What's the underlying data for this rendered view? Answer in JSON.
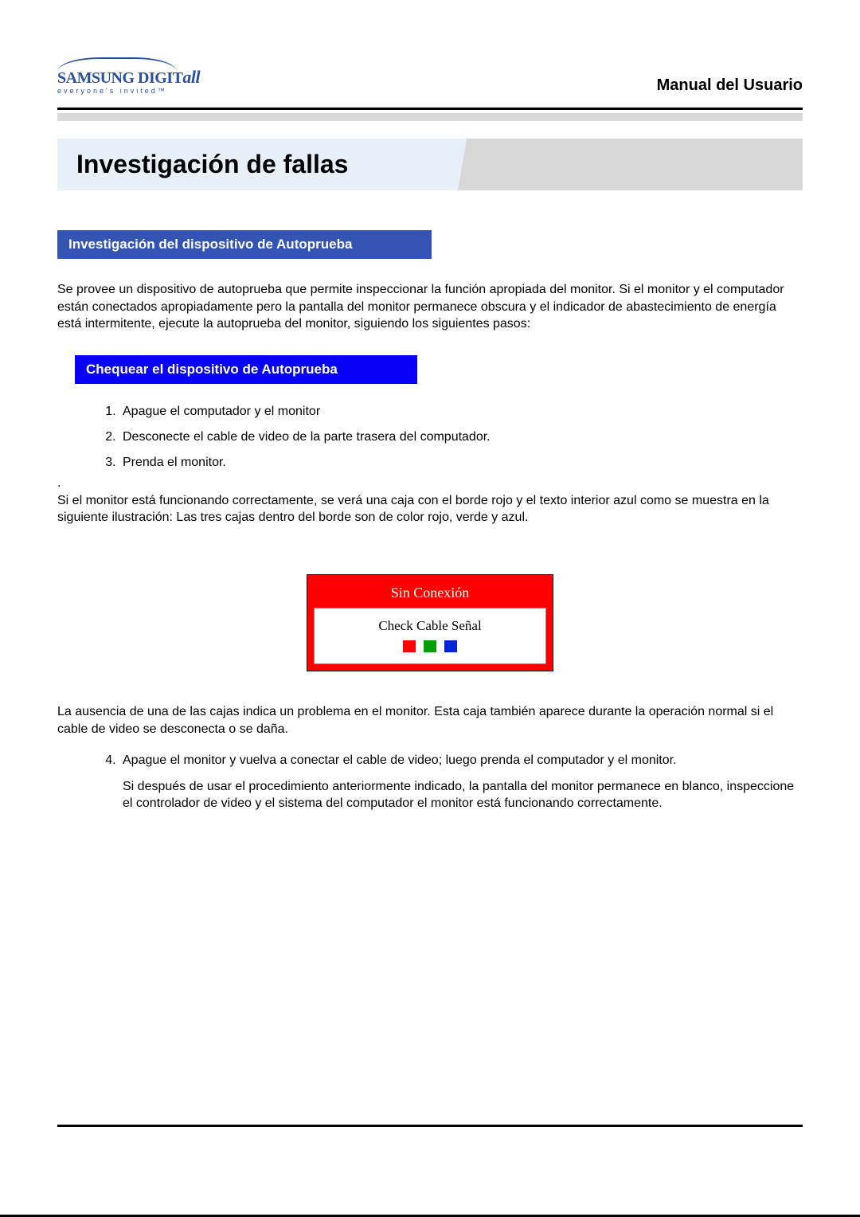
{
  "header": {
    "logo_main_a": "SAMSUNG DIGIT",
    "logo_main_b": "all",
    "logo_sub": "everyone's invited™",
    "title": "Manual del Usuario"
  },
  "title": "Investigación de fallas",
  "section1": {
    "heading": "Investigación del dispositivo de Autoprueba",
    "intro": "Se provee un dispositivo de autoprueba que permite inspeccionar la función apropiada del monitor. Si el monitor y el computador están conectados apropiadamente pero la pantalla del monitor permanece obscura y el indicador de abastecimiento de energía está intermitente, ejecute la autoprueba del monitor, siguiendo los siguientes pasos:"
  },
  "section2": {
    "heading": "Chequear el dispositivo de Autoprueba",
    "steps": [
      "Apague el computador y el monitor",
      "Desconecte el cable de video de la parte trasera del computador.",
      "Prenda el monitor."
    ],
    "dot": ".",
    "result": "Si el monitor está funcionando correctamente, se verá una caja con el borde rojo y el texto interior azul como se muestra en la siguiente ilustración: Las tres cajas dentro del borde son de color rojo, verde y azul."
  },
  "illustration": {
    "title": "Sin Conexión",
    "sub": "Check Cable Señal"
  },
  "after_illus": "La ausencia de una de las cajas indica un problema en el monitor. Esta caja también aparece durante la operación normal si el cable de video se desconecta o se daña.",
  "step4": {
    "num_start": 4,
    "text": "Apague el monitor y vuelva a conectar el cable de video; luego prenda el computador y el monitor.",
    "sub": "Si después de usar el procedimiento anteriormente indicado, la pantalla del monitor permanece en blanco, inspeccione el controlador de video y el sistema del computador el monitor está funcionando correctamente."
  }
}
